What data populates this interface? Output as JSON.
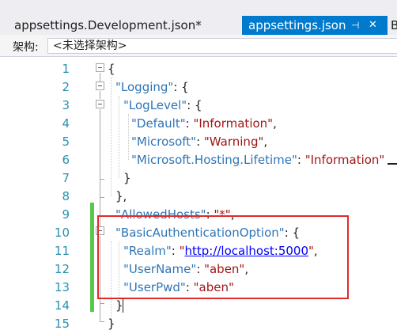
{
  "tabs": {
    "inactive_label": "appsettings.Development.json*",
    "active_label": "appsettings.json",
    "active_pin_icon": "pin-icon",
    "active_close_icon": "close-icon",
    "partial_label": "B"
  },
  "navbar": {
    "label": "架构:",
    "schema_value": "<未选择架构>"
  },
  "editor": {
    "line_numbers": [
      "1",
      "2",
      "3",
      "4",
      "5",
      "6",
      "7",
      "8",
      "9",
      "10",
      "11",
      "12",
      "13",
      "14",
      "15"
    ],
    "lines": [
      [
        {
          "t": "{",
          "c": "p"
        }
      ],
      [
        {
          "t": "\"Logging\"",
          "c": "k"
        },
        {
          "t": ": {",
          "c": "p"
        }
      ],
      [
        {
          "t": "\"LogLevel\"",
          "c": "k"
        },
        {
          "t": ": {",
          "c": "p"
        }
      ],
      [
        {
          "t": "\"Default\"",
          "c": "k"
        },
        {
          "t": ": ",
          "c": "p"
        },
        {
          "t": "\"Information\"",
          "c": "s"
        },
        {
          "t": ",",
          "c": "p"
        }
      ],
      [
        {
          "t": "\"Microsoft\"",
          "c": "k"
        },
        {
          "t": ": ",
          "c": "p"
        },
        {
          "t": "\"Warning\"",
          "c": "s"
        },
        {
          "t": ",",
          "c": "p"
        }
      ],
      [
        {
          "t": "\"Microsoft.Hosting.Lifetime\"",
          "c": "k"
        },
        {
          "t": ": ",
          "c": "p"
        },
        {
          "t": "\"Information\"",
          "c": "s"
        }
      ],
      [
        {
          "t": "}",
          "c": "p"
        }
      ],
      [
        {
          "t": "},",
          "c": "p"
        }
      ],
      [
        {
          "t": "\"AllowedHosts\"",
          "c": "k"
        },
        {
          "t": ": ",
          "c": "p"
        },
        {
          "t": "\"*\"",
          "c": "s"
        },
        {
          "t": ",",
          "c": "p"
        }
      ],
      [
        {
          "t": "\"BasicAuthenticationOption\"",
          "c": "k"
        },
        {
          "t": ": {",
          "c": "p"
        }
      ],
      [
        {
          "t": "\"Realm\"",
          "c": "k"
        },
        {
          "t": ": ",
          "c": "p"
        },
        {
          "t": "\"",
          "c": "s"
        },
        {
          "t": "http://localhost:5000",
          "c": "u"
        },
        {
          "t": "\"",
          "c": "s"
        },
        {
          "t": ",",
          "c": "p"
        }
      ],
      [
        {
          "t": "\"UserName\"",
          "c": "k"
        },
        {
          "t": ": ",
          "c": "p"
        },
        {
          "t": "\"aben\"",
          "c": "s"
        },
        {
          "t": ",",
          "c": "p"
        }
      ],
      [
        {
          "t": "\"UserPwd\"",
          "c": "k"
        },
        {
          "t": ": ",
          "c": "p"
        },
        {
          "t": "\"aben\"",
          "c": "s"
        }
      ],
      [
        {
          "t": "}",
          "c": "p"
        }
      ],
      [
        {
          "t": "}",
          "c": "p"
        }
      ]
    ]
  },
  "colors": {
    "active_tab": "#007acc",
    "line_number": "#2b91af",
    "json_key": "#2e75b6",
    "json_string": "#a31515",
    "change_bar": "#57c94a",
    "highlight": "#e02a2a"
  }
}
